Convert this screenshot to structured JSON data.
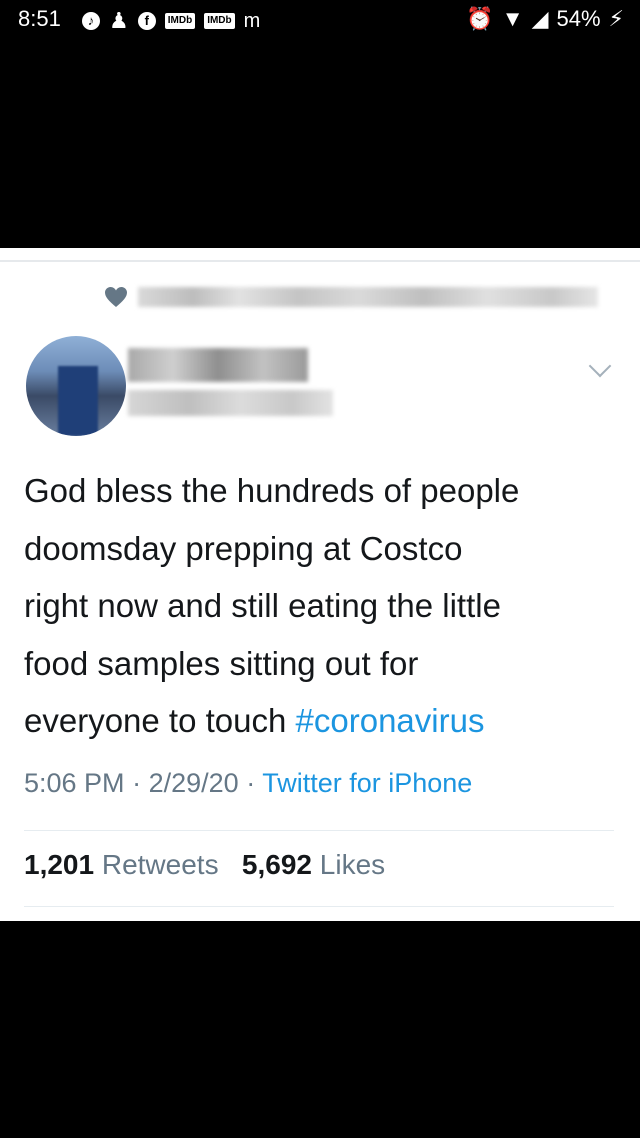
{
  "status_bar": {
    "time": "8:51",
    "imdb_label": "IMDb",
    "battery": "54%"
  },
  "tweet": {
    "text_main": "God bless the hundreds of people\ndoomsday prepping at Costco\nright now and still eating the little\nfood samples sitting out for\neveryone to touch ",
    "hashtag": "#coronavirus",
    "time": "5:06 PM",
    "date": "2/29/20",
    "source": "Twitter for iPhone",
    "retweets_count": "1,201",
    "retweets_label": "Retweets",
    "likes_count": "5,692",
    "likes_label": "Likes"
  },
  "colors": {
    "link": "#1b95e0",
    "text": "#14171a",
    "secondary": "#657786",
    "heart": "#657786"
  }
}
